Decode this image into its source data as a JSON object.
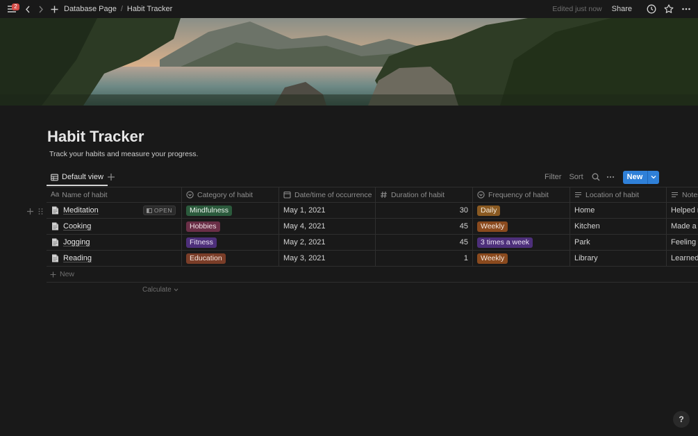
{
  "topbar": {
    "notification_count": "2",
    "breadcrumbs": [
      "Database Page",
      "Habit Tracker"
    ],
    "edited_text": "Edited just now",
    "share_label": "Share"
  },
  "page": {
    "title": "Habit Tracker",
    "description": "Track your habits and measure your progress."
  },
  "view": {
    "tab_label": "Default view",
    "filter_label": "Filter",
    "sort_label": "Sort",
    "new_label": "New"
  },
  "table": {
    "columns": [
      {
        "label": "Name of habit",
        "icon": "text-aa-icon"
      },
      {
        "label": "Category of habit",
        "icon": "select-icon"
      },
      {
        "label": "Date/time of occurrence",
        "icon": "calendar-icon"
      },
      {
        "label": "Duration of habit",
        "icon": "number-hash-icon"
      },
      {
        "label": "Frequency of habit",
        "icon": "select-icon"
      },
      {
        "label": "Location of habit",
        "icon": "text-lines-icon"
      },
      {
        "label": "Notes",
        "icon": "text-lines-icon"
      }
    ],
    "open_label": "OPEN",
    "rows": [
      {
        "name": "Meditation",
        "category": "Mindfulness",
        "date": "May 1, 2021",
        "duration": "30",
        "frequency": "Daily",
        "location": "Home",
        "notes": "Helped m"
      },
      {
        "name": "Cooking",
        "category": "Hobbies",
        "date": "May 4, 2021",
        "duration": "45",
        "frequency": "Weekly",
        "location": "Kitchen",
        "notes": "Made a d"
      },
      {
        "name": "Jogging",
        "category": "Fitness",
        "date": "May 2, 2021",
        "duration": "45",
        "frequency": "3 times a week",
        "location": "Park",
        "notes": "Feeling e"
      },
      {
        "name": "Reading",
        "category": "Education",
        "date": "May 3, 2021",
        "duration": "1",
        "frequency": "Weekly",
        "location": "Library",
        "notes": "Learned"
      }
    ],
    "new_row_label": "New",
    "calculate_label": "Calculate"
  },
  "tag_colors": {
    "Mindfulness": {
      "bg": "#2b5a3c",
      "fg": "#e8f0ea"
    },
    "Hobbies": {
      "bg": "#6a2f47",
      "fg": "#f0e2e8"
    },
    "Fitness": {
      "bg": "#4d2f7a",
      "fg": "#ebe3f5"
    },
    "Education": {
      "bg": "#7a3d28",
      "fg": "#f5e6df"
    },
    "Daily": {
      "bg": "#8a5a22",
      "fg": "#f5ecdf"
    },
    "Weekly": {
      "bg": "#8a4a1e",
      "fg": "#f5e8df"
    },
    "3 times a week": {
      "bg": "#4d2f7a",
      "fg": "#ebe3f5"
    }
  },
  "accent_color": "#2f80d8",
  "help_label": "?"
}
